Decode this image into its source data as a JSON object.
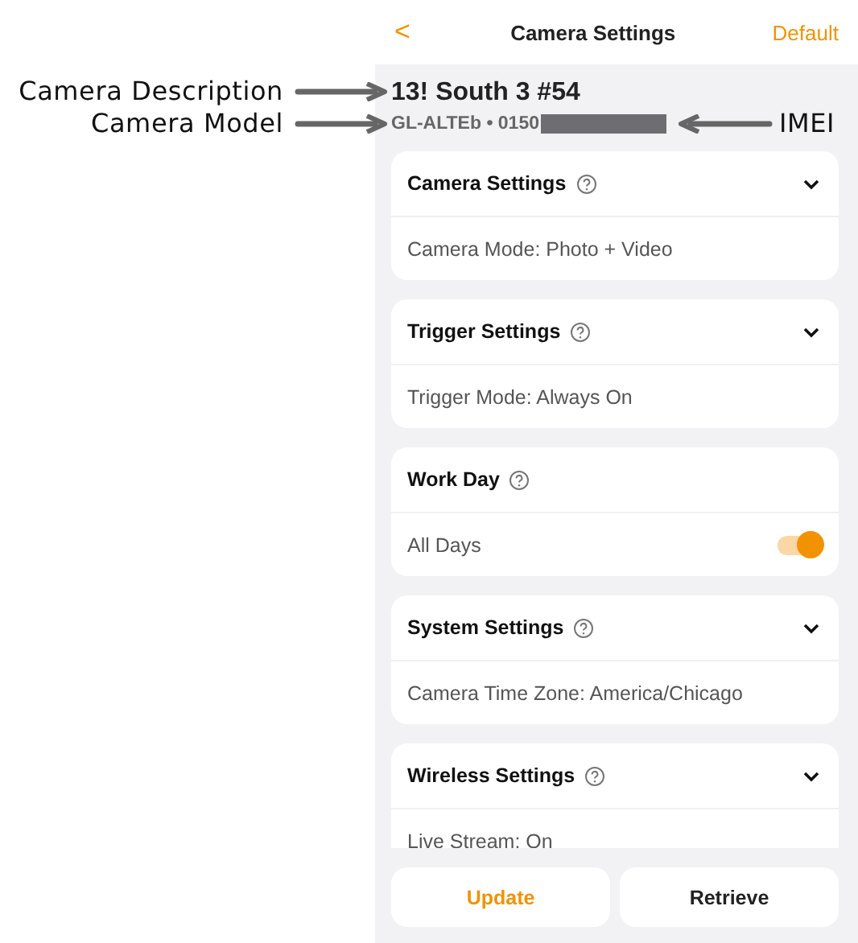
{
  "header": {
    "back": "<",
    "title": "Camera Settings",
    "action": "Default"
  },
  "camera": {
    "description": "13! South 3 #54",
    "model": "GL-ALTEb • 0150",
    "imei_redacted": true
  },
  "annotations": {
    "description_label": "Camera Description",
    "model_label": "Camera Model",
    "imei_label": "IMEI"
  },
  "sections": [
    {
      "title": "Camera Settings",
      "kind": "expandable",
      "expanded": false,
      "value": "Camera Mode: Photo + Video"
    },
    {
      "title": "Trigger Settings",
      "kind": "expandable",
      "expanded": false,
      "value": "Trigger Mode: Always On"
    },
    {
      "title": "Work Day",
      "kind": "toggle",
      "on": true,
      "value": "All Days"
    },
    {
      "title": "System Settings",
      "kind": "expandable",
      "expanded": false,
      "value": "Camera Time Zone: America/Chicago"
    },
    {
      "title": "Wireless Settings",
      "kind": "expandable",
      "expanded": false,
      "value": "Live Stream: On"
    }
  ],
  "buttons": [
    {
      "label": "Update",
      "primary": true
    },
    {
      "label": "Retrieve",
      "primary": false
    }
  ]
}
